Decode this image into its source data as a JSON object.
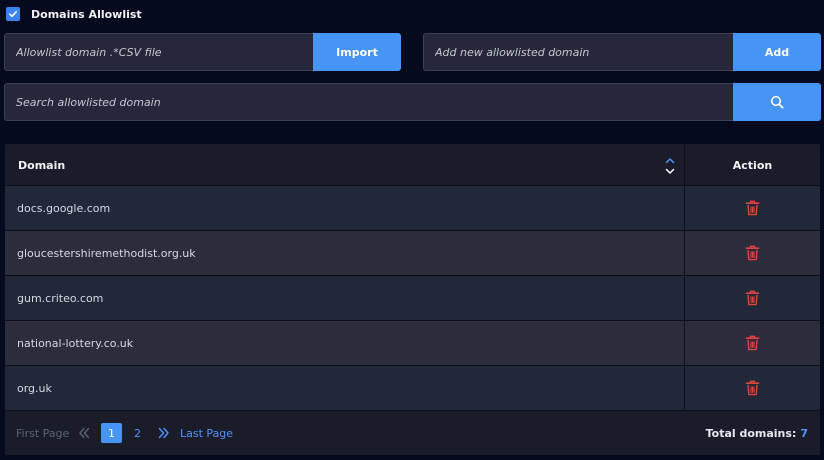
{
  "header": {
    "checkbox_checked": true,
    "title": "Domains Allowlist"
  },
  "import": {
    "placeholder": "Allowlist domain .*CSV file",
    "button_label": "Import"
  },
  "add": {
    "placeholder": "Add new allowlisted domain",
    "button_label": "Add"
  },
  "search": {
    "placeholder": "Search allowlisted domain",
    "icon": "search-icon"
  },
  "table": {
    "columns": {
      "domain": "Domain",
      "action": "Action"
    },
    "rows": [
      {
        "domain": "docs.google.com"
      },
      {
        "domain": "gloucestershiremethodist.org.uk"
      },
      {
        "domain": "gum.criteo.com"
      },
      {
        "domain": "national-lottery.co.uk"
      },
      {
        "domain": "org.uk"
      }
    ],
    "action_icon": "trash-icon"
  },
  "pagination": {
    "first_label": "First Page",
    "pages": [
      "1",
      "2"
    ],
    "current_page": "1",
    "last_label": "Last Page"
  },
  "footer": {
    "total_label": "Total domains:",
    "total_count": "7"
  },
  "colors": {
    "accent": "#4695f6",
    "background": "#050a1e",
    "trash": "#e0443e",
    "link": "#4f94ff"
  }
}
